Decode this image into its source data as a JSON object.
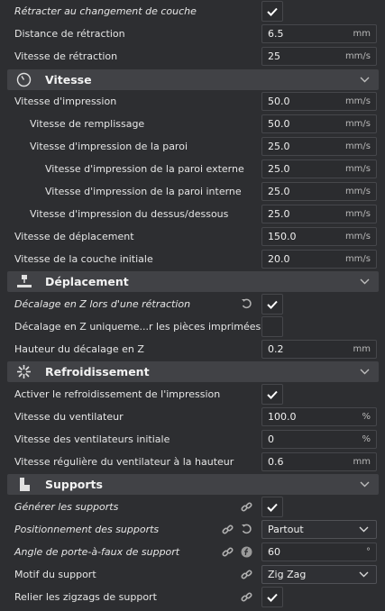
{
  "settings": {
    "retract_layer_change": {
      "label": "Rétracter au changement de couche",
      "checked": true
    },
    "retraction_distance": {
      "label": "Distance de rétraction",
      "value": "6.5",
      "unit": "mm"
    },
    "retraction_speed": {
      "label": "Vitesse de rétraction",
      "value": "25",
      "unit": "mm/s"
    }
  },
  "sections": {
    "speed": {
      "title": "Vitesse",
      "icon": "speedometer-icon"
    },
    "travel": {
      "title": "Déplacement",
      "icon": "travel-icon"
    },
    "cooling": {
      "title": "Refroidissement",
      "icon": "fan-icon"
    },
    "support": {
      "title": "Supports",
      "icon": "support-icon"
    }
  },
  "speed": {
    "print_speed": {
      "label": "Vitesse d'impression",
      "value": "50.0",
      "unit": "mm/s"
    },
    "infill_speed": {
      "label": "Vitesse de remplissage",
      "value": "50.0",
      "unit": "mm/s"
    },
    "wall_speed": {
      "label": "Vitesse d'impression de la paroi",
      "value": "25.0",
      "unit": "mm/s"
    },
    "outer_wall_speed": {
      "label": "Vitesse d'impression de la paroi externe",
      "value": "25.0",
      "unit": "mm/s"
    },
    "inner_wall_speed": {
      "label": "Vitesse d'impression de la paroi interne",
      "value": "25.0",
      "unit": "mm/s"
    },
    "topbottom_speed": {
      "label": "Vitesse d'impression du dessus/dessous",
      "value": "25.0",
      "unit": "mm/s"
    },
    "travel_speed": {
      "label": "Vitesse de déplacement",
      "value": "150.0",
      "unit": "mm/s"
    },
    "initial_layer_speed": {
      "label": "Vitesse de la couche initiale",
      "value": "20.0",
      "unit": "mm/s"
    }
  },
  "travel": {
    "zhop_retract": {
      "label": "Décalage en Z lors d'une rétraction",
      "checked": true
    },
    "zhop_only_printed": {
      "label": "Décalage en Z uniqueme...r les pièces imprimées",
      "checked": false
    },
    "zhop_height": {
      "label": "Hauteur du décalage en Z",
      "value": "0.2",
      "unit": "mm"
    }
  },
  "cooling": {
    "enable_cooling": {
      "label": "Activer le refroidissement de l'impression",
      "checked": true
    },
    "fan_speed": {
      "label": "Vitesse du ventilateur",
      "value": "100.0",
      "unit": "%"
    },
    "initial_fan_speed": {
      "label": "Vitesse des ventilateurs initiale",
      "value": "0",
      "unit": "%"
    },
    "regular_fan_height": {
      "label": "Vitesse régulière du ventilateur à la hauteur",
      "value": "0.6",
      "unit": "mm"
    }
  },
  "support": {
    "generate": {
      "label": "Générer les supports",
      "checked": true
    },
    "placement": {
      "label": "Positionnement des supports",
      "value": "Partout"
    },
    "overhang_angle": {
      "label": "Angle de porte-à-faux de support",
      "value": "60",
      "unit": "°"
    },
    "pattern": {
      "label": "Motif du support",
      "value": "Zig Zag"
    },
    "connect_zigzags": {
      "label": "Relier les zigzags de support",
      "checked": true
    }
  },
  "colors": {
    "background": "#2d2e31",
    "section_header": "#414246",
    "field_border": "#46474b"
  }
}
